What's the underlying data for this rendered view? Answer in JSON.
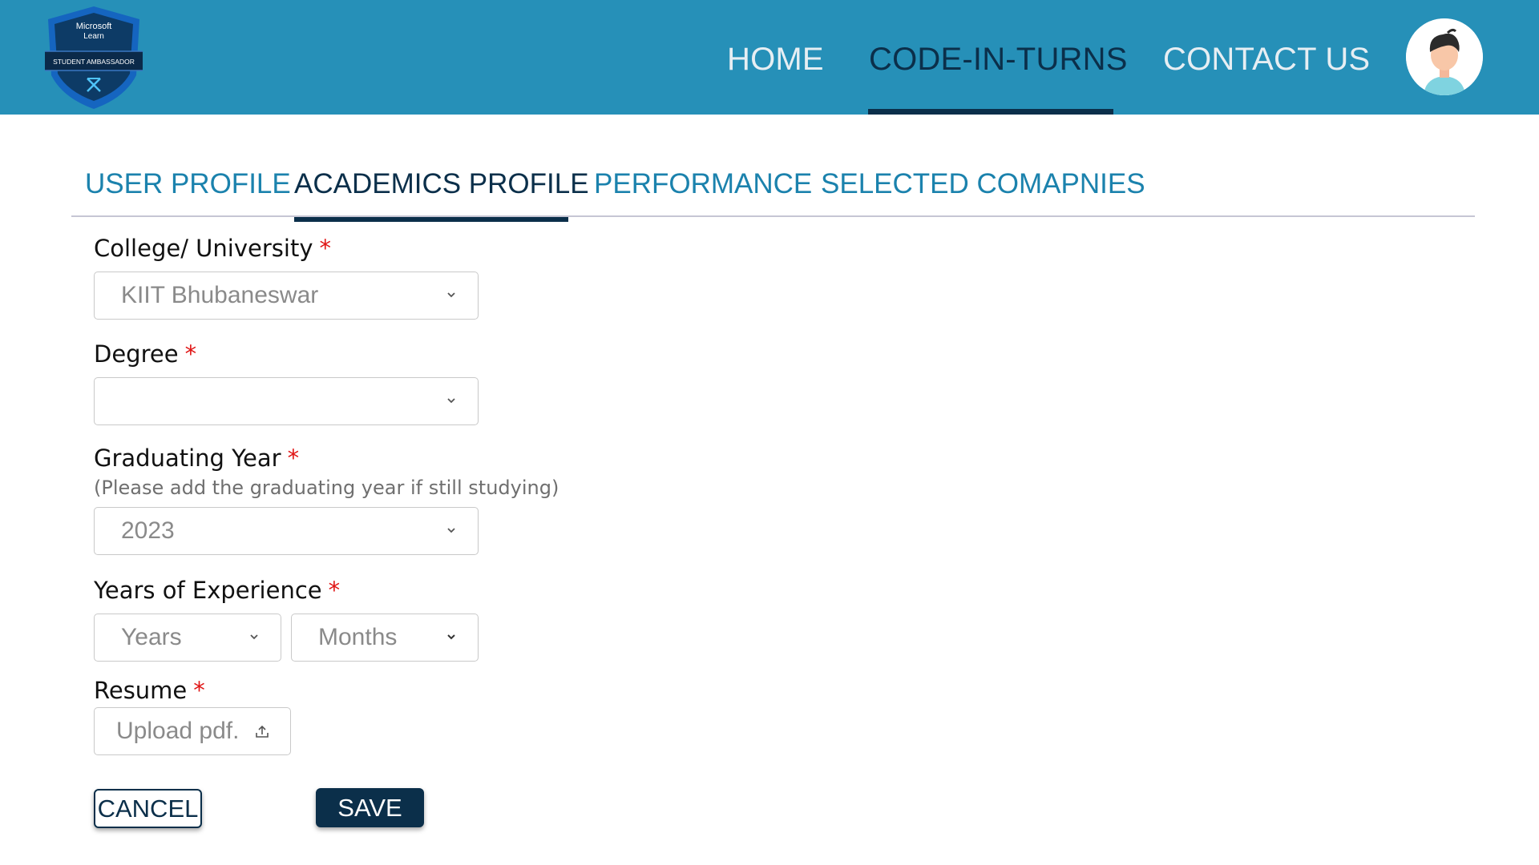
{
  "brand": {
    "logo_line1": "Microsoft",
    "logo_line2": "Learn",
    "logo_banner": "STUDENT AMBASSADOR"
  },
  "nav": {
    "items": [
      {
        "label": "HOME"
      },
      {
        "label": "CODE-IN-TURNS",
        "active": true
      },
      {
        "label": "CONTACT US"
      }
    ],
    "avatar_icon": "user-avatar-icon"
  },
  "tabs": [
    {
      "label": "USER PROFILE"
    },
    {
      "label": "ACADEMICS PROFILE",
      "active": true
    },
    {
      "label": "PERFORMANCE"
    },
    {
      "label": "SELECTED COMAPNIES"
    }
  ],
  "form": {
    "college": {
      "label": "College/ University",
      "required_mark": "*",
      "value": "KIIT Bhubaneswar"
    },
    "degree": {
      "label": "Degree",
      "required_mark": "*",
      "value": ""
    },
    "graduating_year": {
      "label": "Graduating Year",
      "required_mark": "*",
      "hint": "(Please add the graduating year if still studying)",
      "value": "2023"
    },
    "experience": {
      "label": "Years of Experience",
      "required_mark": "*",
      "years_placeholder": "Years",
      "months_placeholder": "Months"
    },
    "resume": {
      "label": "Resume",
      "required_mark": "*",
      "placeholder": "Upload pdf."
    }
  },
  "actions": {
    "cancel_label": "CANCEL",
    "save_label": "SAVE"
  },
  "colors": {
    "header_bg": "#2690b8",
    "nav_active": "#0b2f4a",
    "tab_text": "#1b82ad",
    "required": "#e01515",
    "button_dark": "#0b2f4a"
  }
}
